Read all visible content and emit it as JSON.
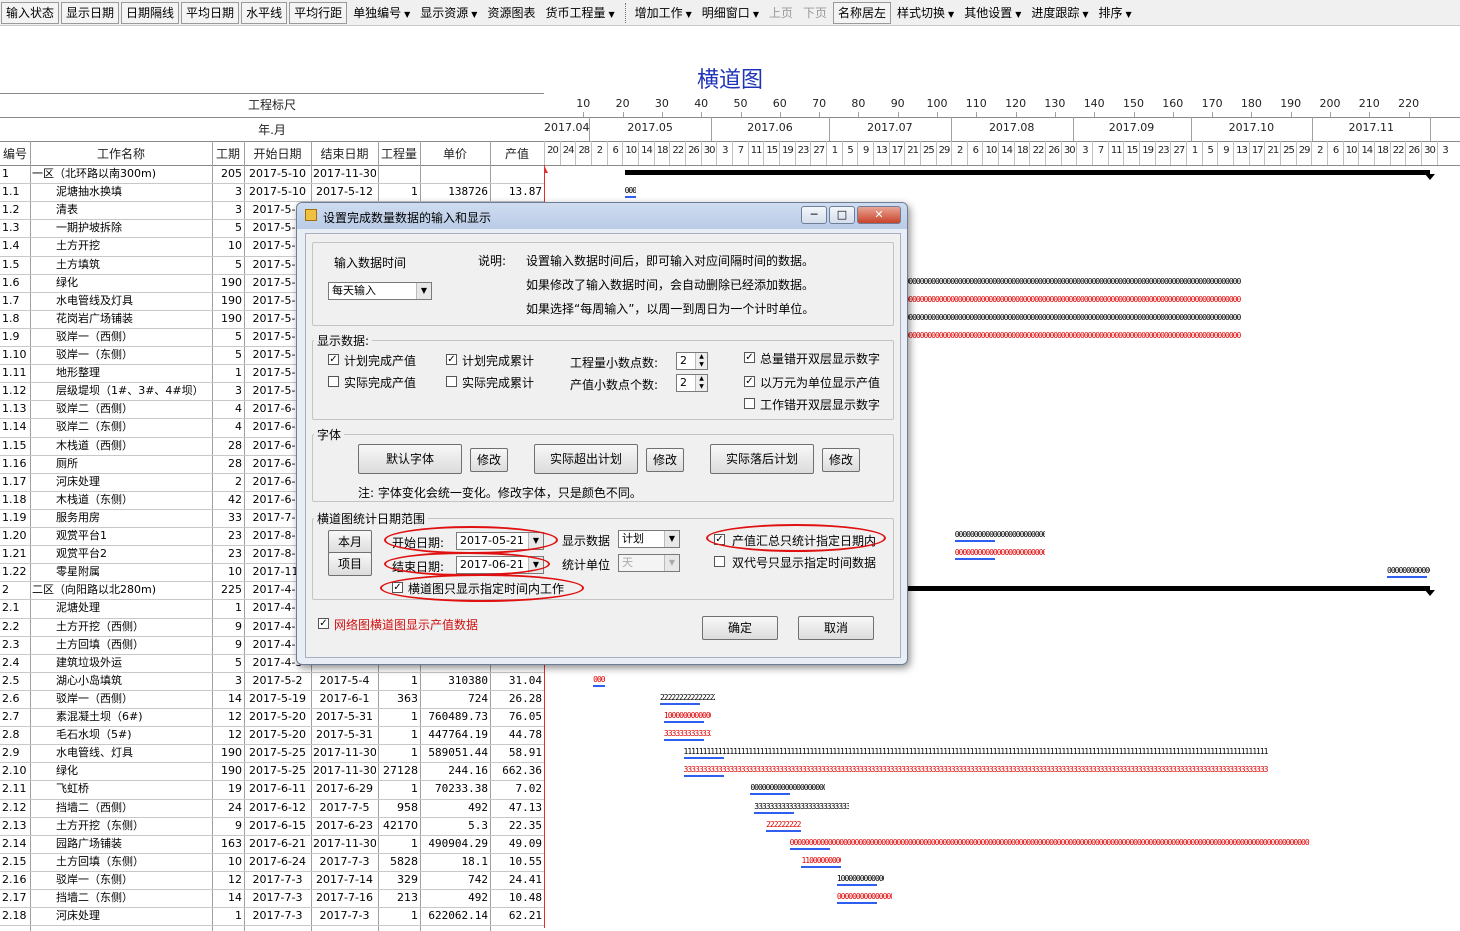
{
  "toolbar": {
    "buttons": [
      "输入状态",
      "显示日期",
      "日期隔线",
      "平均日期",
      "水平线",
      "平均行距"
    ],
    "menus1": [
      "单独编号",
      "显示资源"
    ],
    "plain1": [
      "资源图表"
    ],
    "menus2": [
      "货币工程量"
    ],
    "menus3": [
      "增加工作",
      "明细窗口"
    ],
    "disabled": [
      "上页",
      "下页"
    ],
    "btn2": [
      "名称居左"
    ],
    "menus4": [
      "样式切换",
      "其他设置",
      "进度跟踪",
      "排序"
    ]
  },
  "chart_title": "横道图",
  "grid": {
    "scale_label": "工程标尺",
    "yearmonth_label": "年.月",
    "columns": [
      "编号",
      "工作名称",
      "工期",
      "开始日期",
      "结束日期",
      "工程量",
      "单价",
      "产值"
    ],
    "rows": [
      {
        "id": "1",
        "name": "一区（北环路以南300m)",
        "dur": "205",
        "start": "2017-5-10",
        "end": "2017-11-30",
        "qty": "",
        "price": "",
        "val": "",
        "group": true
      },
      {
        "id": "1.1",
        "name": "泥塘抽水换填",
        "dur": "3",
        "start": "2017-5-10",
        "end": "2017-5-12",
        "qty": "1",
        "price": "138726",
        "val": "13.87"
      },
      {
        "id": "1.2",
        "name": "清表",
        "dur": "3",
        "start": "2017-5-1",
        "end": "",
        "qty": "",
        "price": "",
        "val": ""
      },
      {
        "id": "1.3",
        "name": "一期护坡拆除",
        "dur": "5",
        "start": "2017-5-1",
        "end": "",
        "qty": "",
        "price": "",
        "val": ""
      },
      {
        "id": "1.4",
        "name": "土方开挖",
        "dur": "10",
        "start": "2017-5-1",
        "end": "",
        "qty": "",
        "price": "",
        "val": ""
      },
      {
        "id": "1.5",
        "name": "土方填筑",
        "dur": "5",
        "start": "2017-5-1",
        "end": "",
        "qty": "",
        "price": "",
        "val": ""
      },
      {
        "id": "1.6",
        "name": "绿化",
        "dur": "190",
        "start": "2017-5-2",
        "end": "",
        "qty": "",
        "price": "",
        "val": ""
      },
      {
        "id": "1.7",
        "name": "水电管线及灯具",
        "dur": "190",
        "start": "2017-5-2",
        "end": "",
        "qty": "",
        "price": "",
        "val": ""
      },
      {
        "id": "1.8",
        "name": "花岗岩广场铺装",
        "dur": "190",
        "start": "2017-5-2",
        "end": "",
        "qty": "",
        "price": "",
        "val": ""
      },
      {
        "id": "1.9",
        "name": "驳岸一（西侧）",
        "dur": "5",
        "start": "2017-5-2",
        "end": "",
        "qty": "",
        "price": "",
        "val": ""
      },
      {
        "id": "1.10",
        "name": "驳岸一（东侧）",
        "dur": "5",
        "start": "2017-5-2",
        "end": "",
        "qty": "",
        "price": "",
        "val": ""
      },
      {
        "id": "1.11",
        "name": "地形整理",
        "dur": "1",
        "start": "2017-5-2",
        "end": "",
        "qty": "",
        "price": "",
        "val": ""
      },
      {
        "id": "1.12",
        "name": "层级堤坝（1#、3#、4#坝）",
        "dur": "3",
        "start": "2017-5-2",
        "end": "",
        "qty": "",
        "price": "",
        "val": ""
      },
      {
        "id": "1.13",
        "name": "驳岸二（西侧）",
        "dur": "4",
        "start": "2017-6-1",
        "end": "",
        "qty": "",
        "price": "",
        "val": ""
      },
      {
        "id": "1.14",
        "name": "驳岸二（东侧）",
        "dur": "4",
        "start": "2017-6-1",
        "end": "",
        "qty": "",
        "price": "",
        "val": ""
      },
      {
        "id": "1.15",
        "name": "木栈道（西侧）",
        "dur": "28",
        "start": "2017-6-1",
        "end": "",
        "qty": "",
        "price": "",
        "val": ""
      },
      {
        "id": "1.16",
        "name": "厕所",
        "dur": "28",
        "start": "2017-6-1",
        "end": "",
        "qty": "",
        "price": "",
        "val": ""
      },
      {
        "id": "1.17",
        "name": "河床处理",
        "dur": "2",
        "start": "2017-6-1",
        "end": "",
        "qty": "",
        "price": "",
        "val": ""
      },
      {
        "id": "1.18",
        "name": "木栈道（东侧）",
        "dur": "42",
        "start": "2017-6-1",
        "end": "",
        "qty": "",
        "price": "",
        "val": ""
      },
      {
        "id": "1.19",
        "name": "服务用房",
        "dur": "33",
        "start": "2017-7-1",
        "end": "",
        "qty": "",
        "price": "",
        "val": ""
      },
      {
        "id": "1.20",
        "name": "观赏平台1",
        "dur": "23",
        "start": "2017-8-2",
        "end": "",
        "qty": "",
        "price": "",
        "val": ""
      },
      {
        "id": "1.21",
        "name": "观赏平台2",
        "dur": "23",
        "start": "2017-8-2",
        "end": "",
        "qty": "",
        "price": "",
        "val": ""
      },
      {
        "id": "1.22",
        "name": "零星附属",
        "dur": "10",
        "start": "2017-11-",
        "end": "",
        "qty": "",
        "price": "",
        "val": ""
      },
      {
        "id": "2",
        "name": "二区（向阳路以北280m)",
        "dur": "225",
        "start": "2017-4-2",
        "end": "",
        "qty": "",
        "price": "",
        "val": "",
        "group": true
      },
      {
        "id": "2.1",
        "name": "泥塘处理",
        "dur": "1",
        "start": "2017-4-2",
        "end": "",
        "qty": "",
        "price": "",
        "val": ""
      },
      {
        "id": "2.2",
        "name": "土方开挖（西侧）",
        "dur": "9",
        "start": "2017-4-2",
        "end": "",
        "qty": "",
        "price": "",
        "val": ""
      },
      {
        "id": "2.3",
        "name": "土方回填（西侧）",
        "dur": "9",
        "start": "2017-4-2",
        "end": "",
        "qty": "",
        "price": "",
        "val": ""
      },
      {
        "id": "2.4",
        "name": "建筑垃圾外运",
        "dur": "5",
        "start": "2017-4-3",
        "end": "",
        "qty": "",
        "price": "",
        "val": ""
      },
      {
        "id": "2.5",
        "name": "湖心小岛填筑",
        "dur": "3",
        "start": "2017-5-2",
        "end": "2017-5-4",
        "qty": "1",
        "price": "310380",
        "val": "31.04"
      },
      {
        "id": "2.6",
        "name": "驳岸一（西侧）",
        "dur": "14",
        "start": "2017-5-19",
        "end": "2017-6-1",
        "qty": "363",
        "price": "724",
        "val": "26.28"
      },
      {
        "id": "2.7",
        "name": "素混凝土坝（6#)",
        "dur": "12",
        "start": "2017-5-20",
        "end": "2017-5-31",
        "qty": "1",
        "price": "760489.73",
        "val": "76.05"
      },
      {
        "id": "2.8",
        "name": "毛石水坝（5#)",
        "dur": "12",
        "start": "2017-5-20",
        "end": "2017-5-31",
        "qty": "1",
        "price": "447764.19",
        "val": "44.78"
      },
      {
        "id": "2.9",
        "name": "水电管线、灯具",
        "dur": "190",
        "start": "2017-5-25",
        "end": "2017-11-30",
        "qty": "1",
        "price": "589051.44",
        "val": "58.91"
      },
      {
        "id": "2.10",
        "name": "绿化",
        "dur": "190",
        "start": "2017-5-25",
        "end": "2017-11-30",
        "qty": "27128",
        "price": "244.16",
        "val": "662.36"
      },
      {
        "id": "2.11",
        "name": "飞虹桥",
        "dur": "19",
        "start": "2017-6-11",
        "end": "2017-6-29",
        "qty": "1",
        "price": "70233.38",
        "val": "7.02"
      },
      {
        "id": "2.12",
        "name": "挡墙二（西侧）",
        "dur": "24",
        "start": "2017-6-12",
        "end": "2017-7-5",
        "qty": "958",
        "price": "492",
        "val": "47.13"
      },
      {
        "id": "2.13",
        "name": "土方开挖（东侧）",
        "dur": "9",
        "start": "2017-6-15",
        "end": "2017-6-23",
        "qty": "42170",
        "price": "5.3",
        "val": "22.35"
      },
      {
        "id": "2.14",
        "name": "园路广场铺装",
        "dur": "163",
        "start": "2017-6-21",
        "end": "2017-11-30",
        "qty": "1",
        "price": "490904.29",
        "val": "49.09"
      },
      {
        "id": "2.15",
        "name": "土方回填（东侧）",
        "dur": "10",
        "start": "2017-6-24",
        "end": "2017-7-3",
        "qty": "5828",
        "price": "18.1",
        "val": "10.55"
      },
      {
        "id": "2.16",
        "name": "驳岸一（东侧）",
        "dur": "12",
        "start": "2017-7-3",
        "end": "2017-7-14",
        "qty": "329",
        "price": "742",
        "val": "24.41"
      },
      {
        "id": "2.17",
        "name": "挡墙二（东侧）",
        "dur": "14",
        "start": "2017-7-3",
        "end": "2017-7-16",
        "qty": "213",
        "price": "492",
        "val": "10.48"
      },
      {
        "id": "2.18",
        "name": "河床处理",
        "dur": "1",
        "start": "2017-7-3",
        "end": "2017-7-3",
        "qty": "1",
        "price": "622062.14",
        "val": "62.21"
      }
    ]
  },
  "gantt": {
    "scale_ticks": [
      "10",
      "20",
      "30",
      "40",
      "50",
      "60",
      "70",
      "80",
      "90",
      "100",
      "110",
      "120",
      "130",
      "140",
      "150",
      "160",
      "170",
      "180",
      "190",
      "200",
      "210",
      "220"
    ],
    "months": [
      "2017.04",
      "2017.05",
      "2017.06",
      "2017.07",
      "2017.08",
      "2017.09",
      "2017.10",
      "2017.11"
    ],
    "days": [
      "20",
      "24",
      "28",
      "2",
      "6",
      "10",
      "14",
      "18",
      "22",
      "26",
      "30",
      "3",
      "7",
      "11",
      "15",
      "19",
      "23",
      "27",
      "1",
      "5",
      "9",
      "13",
      "17",
      "21",
      "25",
      "29",
      "2",
      "6",
      "10",
      "14",
      "18",
      "22",
      "26",
      "30",
      "3",
      "7",
      "11",
      "15",
      "19",
      "23",
      "27",
      "1",
      "5",
      "9",
      "13",
      "17",
      "21",
      "25",
      "29",
      "2",
      "6",
      "10",
      "14",
      "18",
      "22",
      "26",
      "30",
      "3"
    ],
    "bar_colors": {
      "plan": "#000000",
      "actual": "#e00000",
      "line": "#2f5ff0"
    },
    "bars": [
      {
        "row": 0,
        "start": "2017-5-10",
        "end": "2017-11-30",
        "kind": "summary"
      },
      {
        "row": 1,
        "start": "2017-5-10",
        "end": "2017-5-12",
        "kind": "plan",
        "text": "000000000"
      },
      {
        "row": 2,
        "start": "2017-5-10",
        "end": "2017-5-12",
        "kind": "actual",
        "text": "000000000"
      },
      {
        "row": 6,
        "start": "2017-5-21",
        "end": "2017-11-30",
        "kind": "plan",
        "text": "000000000000000000000000000000000000000000000000000000000000000000000000000000000000000000000000000000000000000000000000000000000000000000000000000000"
      },
      {
        "row": 7,
        "start": "2017-5-21",
        "end": "2017-11-30",
        "kind": "actual",
        "text": "000000000000000000000000000000000000000000000000000000000000000000000000000000000000000000000000000000000000000000000000000000000000000000000000000000"
      },
      {
        "row": 8,
        "start": "2017-5-21",
        "end": "2017-11-30",
        "kind": "plan",
        "text": "000000000000000000000000000000000000000000000000000000000000000000000000000000000000000000000000000000000000000000000000000000000000000000000000000000"
      },
      {
        "row": 9,
        "start": "2017-5-21",
        "end": "2017-11-30",
        "kind": "actual",
        "text": "000000000000000000000000000000000000000000000000000000000000000000000000000000000000000000000000000000000000000000000000000000000000000000000000000000"
      },
      {
        "row": 18,
        "start": "2017-6-1",
        "end": "2017-7-12",
        "kind": "plan",
        "text": "0000000000000000000"
      },
      {
        "row": 19,
        "start": "2017-6-1",
        "end": "2017-7-12",
        "kind": "actual",
        "text": "0000000000000000000000000000000000000000000000000000000000000"
      },
      {
        "row": 20,
        "start": "2017-8-2",
        "end": "2017-8-24",
        "kind": "plan",
        "text": "000000000000000000000000000000"
      },
      {
        "row": 21,
        "start": "2017-8-2",
        "end": "2017-8-24",
        "kind": "actual",
        "text": "0000000000000000000000000000000000"
      },
      {
        "row": 22,
        "start": "2017-11-20",
        "end": "2017-11-30",
        "kind": "plan",
        "text": "0000000000001"
      },
      {
        "row": 23,
        "start": "2017-4-20",
        "end": "2017-11-30",
        "kind": "summary"
      },
      {
        "row": 28,
        "start": "2017-5-2",
        "end": "2017-5-4",
        "kind": "actual",
        "text": "000000000"
      },
      {
        "row": 29,
        "start": "2017-5-19",
        "end": "2017-6-1",
        "kind": "plan",
        "text": "22222222222222222222222"
      },
      {
        "row": 30,
        "start": "2017-5-20",
        "end": "2017-5-31",
        "kind": "actual",
        "text": "1000000000000000000000"
      },
      {
        "row": 31,
        "start": "2017-5-20",
        "end": "2017-5-31",
        "kind": "actual",
        "text": "33333333333333333333333"
      },
      {
        "row": 32,
        "start": "2017-5-25",
        "end": "2017-11-30",
        "kind": "plan",
        "text": "111111111111111111111111111111111111111111111111111111111111111111111111111111111111111111111111111111111111111111111111111111111111111111111111111111111"
      },
      {
        "row": 33,
        "start": "2017-5-25",
        "end": "2017-11-30",
        "kind": "actual",
        "text": "333333333333333333333333333333333333333333333333333333333333333333333333333333333333333333333333333333333333333333333333333333333333333333333333333333333"
      },
      {
        "row": 34,
        "start": "2017-6-11",
        "end": "2017-6-29",
        "kind": "plan",
        "text": "0000000000000000000000000000000"
      },
      {
        "row": 35,
        "start": "2017-6-12",
        "end": "2017-7-5",
        "kind": "plan",
        "text": "333333333333333333333333333333"
      },
      {
        "row": 36,
        "start": "2017-6-15",
        "end": "2017-6-23",
        "kind": "actual",
        "text": "222222222222222222222222"
      },
      {
        "row": 37,
        "start": "2017-6-21",
        "end": "2017-11-30",
        "kind": "actual",
        "text": "0000000000000000000000000000000000000000000000000000000000000000000000000000000000000000000000000000000000000000000000000000000000000000"
      },
      {
        "row": 38,
        "start": "2017-6-24",
        "end": "2017-7-3",
        "kind": "actual",
        "text": "11000000000000000000000"
      },
      {
        "row": 39,
        "start": "2017-7-3",
        "end": "2017-7-14",
        "kind": "plan",
        "text": "1000000000000000000000"
      },
      {
        "row": 40,
        "start": "2017-7-3",
        "end": "2017-7-16",
        "kind": "actual",
        "text": "000000000000000000000"
      }
    ]
  },
  "dialog": {
    "title": "设置完成数量数据的输入和显示",
    "input_time_label": "输入数据时间",
    "input_time_value": "每天输入",
    "note_label": "说明:",
    "note_lines": [
      "设置输入数据时间后，即可输入对应间隔时间的数据。",
      "如果修改了输入数据时间，会自动删除已经添加数据。",
      "如果选择“每周输入”，以周一到周日为一个计时单位。"
    ],
    "display_group": "显示数据:",
    "chk_plan_output": "计划完成产值",
    "chk_plan_cum": "计划完成累计",
    "chk_actual_output": "实际完成产值",
    "chk_actual_cum": "实际完成累计",
    "qty_decimals_label": "工程量小数点数:",
    "qty_decimals": "2",
    "val_decimals_label": "产值小数点个数:",
    "val_decimals": "2",
    "chk_total_double": "总量错开双层显示数字",
    "chk_wan_unit": "以万元为单位显示产值",
    "chk_work_double": "工作错开双层显示数字",
    "font_group": "字体",
    "font_default": "默认字体",
    "font_over": "实际超出计划",
    "font_behind": "实际落后计划",
    "modify": "修改",
    "font_note": "注: 字体变化会统一变化。修改字体，只是颜色不同。",
    "range_group": "横道图统计日期范围",
    "btn_month": "本月",
    "btn_item": "项目",
    "start_label": "开始日期:",
    "start_value": "2017-05-21",
    "end_label": "结束日期:",
    "end_value": "2017-06-21",
    "show_data_label": "显示数据",
    "show_data_value": "计划",
    "stat_unit_label": "统计单位",
    "stat_unit_value": "天",
    "chk_output_range": "产值汇总只统计指定日期内",
    "chk_double_code": "双代号只显示指定时间数据",
    "chk_gantt_range": "横道图只显示指定时间内工作",
    "chk_network": "网络图横道图显示产值数据",
    "ok": "确定",
    "cancel": "取消"
  }
}
